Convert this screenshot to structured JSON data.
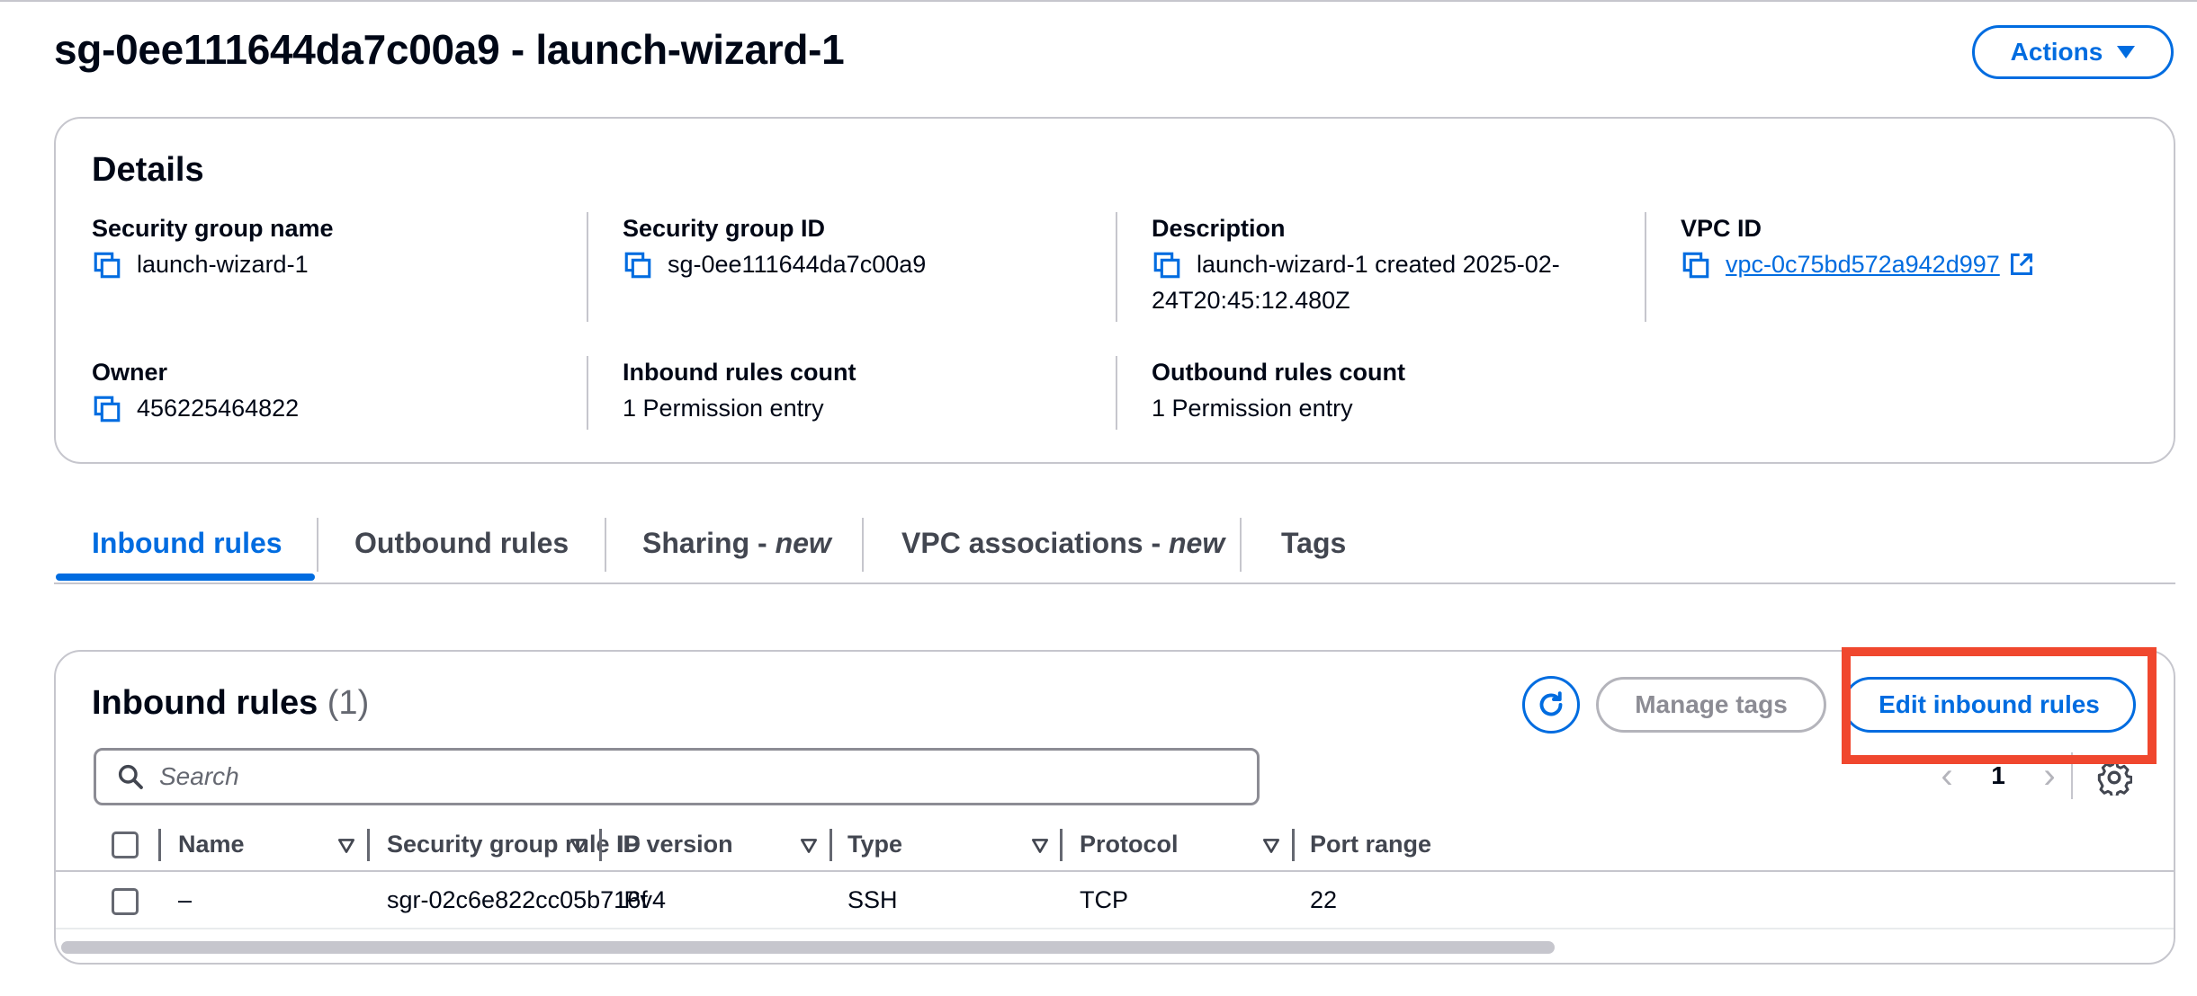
{
  "page": {
    "title": "sg-0ee111644da7c00a9 - launch-wizard-1",
    "actions_label": "Actions"
  },
  "details": {
    "heading": "Details",
    "security_group_name": {
      "label": "Security group name",
      "value": "launch-wizard-1"
    },
    "security_group_id": {
      "label": "Security group ID",
      "value": "sg-0ee111644da7c00a9"
    },
    "description": {
      "label": "Description",
      "value_line1": "launch-wizard-1 created 2025-02-",
      "value_line2": "24T20:45:12.480Z"
    },
    "vpc_id": {
      "label": "VPC ID",
      "value": "vpc-0c75bd572a942d997"
    },
    "owner": {
      "label": "Owner",
      "value": "456225464822"
    },
    "inbound_rules_count": {
      "label": "Inbound rules count",
      "value": "1 Permission entry"
    },
    "outbound_rules_count": {
      "label": "Outbound rules count",
      "value": "1 Permission entry"
    }
  },
  "tabs": [
    {
      "label": "Inbound rules",
      "suffix": "",
      "active": true
    },
    {
      "label": "Outbound rules",
      "suffix": "",
      "active": false
    },
    {
      "label": "Sharing - ",
      "suffix": "new",
      "active": false
    },
    {
      "label": "VPC associations - ",
      "suffix": "new",
      "active": false
    },
    {
      "label": "Tags",
      "suffix": "",
      "active": false
    }
  ],
  "inbound": {
    "heading": "Inbound rules",
    "count": "(1)",
    "manage_tags_label": "Manage tags",
    "edit_label": "Edit inbound rules",
    "search_placeholder": "Search",
    "page_number": "1",
    "columns": [
      "Name",
      "Security group rule ID",
      "IP version",
      "Type",
      "Protocol",
      "Port range"
    ],
    "rows": [
      {
        "name": "–",
        "rule_id": "sgr-02c6e822cc05b716f",
        "ip_version": "IPv4",
        "type": "SSH",
        "protocol": "TCP",
        "port_range": "22"
      }
    ]
  },
  "colors": {
    "accent": "#006ce0",
    "highlight": "#f0472e",
    "border": "#c6c6cd",
    "text": "#000716"
  },
  "icons": [
    "copy-icon",
    "external-link-icon",
    "caret-down-icon",
    "refresh-icon",
    "search-icon",
    "chevron-left-icon",
    "chevron-right-icon",
    "settings-gear-icon",
    "sort-triangle-icon"
  ]
}
